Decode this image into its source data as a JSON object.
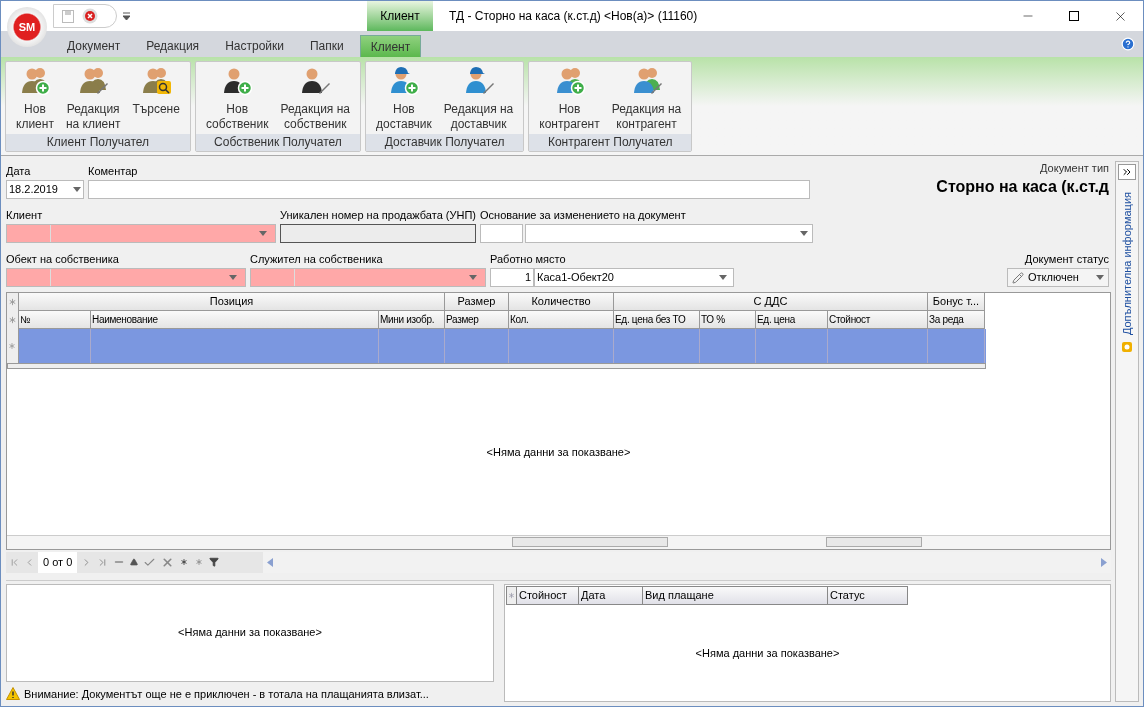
{
  "window": {
    "logo": "SM",
    "context_tab": "Клиент",
    "title": "ТД - Сторно на каса (к.ст.д) <Нов(а)> (11160)"
  },
  "ribbon": {
    "tabs": [
      {
        "label": "Документ",
        "selected": false
      },
      {
        "label": "Редакция",
        "selected": false
      },
      {
        "label": "Настройки",
        "selected": false
      },
      {
        "label": "Папки",
        "selected": false
      },
      {
        "label": "Клиент",
        "selected": true
      }
    ],
    "groups": [
      {
        "label": "Клиент Получател",
        "kind": "client",
        "buttons": [
          {
            "label": "Нов\nклиент",
            "kind": "add"
          },
          {
            "label": "Редакция\nна клиент",
            "kind": "edit"
          },
          {
            "label": "Търсене",
            "kind": "search"
          }
        ]
      },
      {
        "label": "Собственик Получател",
        "kind": "owner",
        "buttons": [
          {
            "label": "Нов\nсобственик",
            "kind": "add"
          },
          {
            "label": "Редакция на\nсобственик",
            "kind": "edit"
          }
        ]
      },
      {
        "label": "Доставчик Получател",
        "kind": "supplier",
        "buttons": [
          {
            "label": "Нов\nдоставчик",
            "kind": "add"
          },
          {
            "label": "Редакция на\nдоставчик",
            "kind": "edit"
          }
        ]
      },
      {
        "label": "Контрагент Получател",
        "kind": "contractor",
        "buttons": [
          {
            "label": "Нов\nконтрагент",
            "kind": "add"
          },
          {
            "label": "Редакция на\nконтрагент",
            "kind": "edit"
          }
        ]
      }
    ]
  },
  "form": {
    "date": {
      "label": "Дата",
      "value": "18.2.2019"
    },
    "comment": {
      "label": "Коментар"
    },
    "document_type": {
      "label": "Документ тип",
      "value": "Сторно на каса (к.ст.д"
    },
    "client": {
      "label": "Клиент",
      "required": true
    },
    "unp": {
      "label": "Уникален номер на продажбата (УНП)",
      "disabled": true
    },
    "basis": {
      "label": "Основание за изменението на документ"
    },
    "owner_object": {
      "label": "Обект на собственика",
      "required": true
    },
    "owner_employee": {
      "label": "Служител на собственика",
      "required": true
    },
    "workplace": {
      "label": "Работно място",
      "code": "1",
      "value": "Каса1-Обект20"
    },
    "document_status": {
      "label": "Документ статус",
      "value": "Отключен"
    }
  },
  "grid": {
    "bands": [
      "Позиция",
      "Размер",
      "Количество",
      "С ДДС",
      "Бонус т..."
    ],
    "columns": [
      "№",
      "Наименование",
      "Мини изобр.",
      "Размер",
      "Кол.",
      "Ед. цена без ТО",
      "ТО %",
      "Ед. цена",
      "Стойност",
      "За реда"
    ],
    "new_row": {
      "selected": true
    },
    "empty_text": "<Няма данни за показване>",
    "navigator": "0 от 0"
  },
  "bottom_left": {
    "empty_text": "<Няма данни за показване>",
    "warning": "Внимание: Документът още не е приключен - в тотала на плащанията влизат..."
  },
  "payments": {
    "columns": [
      "Стойност",
      "Дата",
      "Вид плащане",
      "Статус"
    ],
    "empty_text": "<Няма данни за показване>"
  },
  "side_panel": {
    "label": "Допълнителна информация"
  }
}
